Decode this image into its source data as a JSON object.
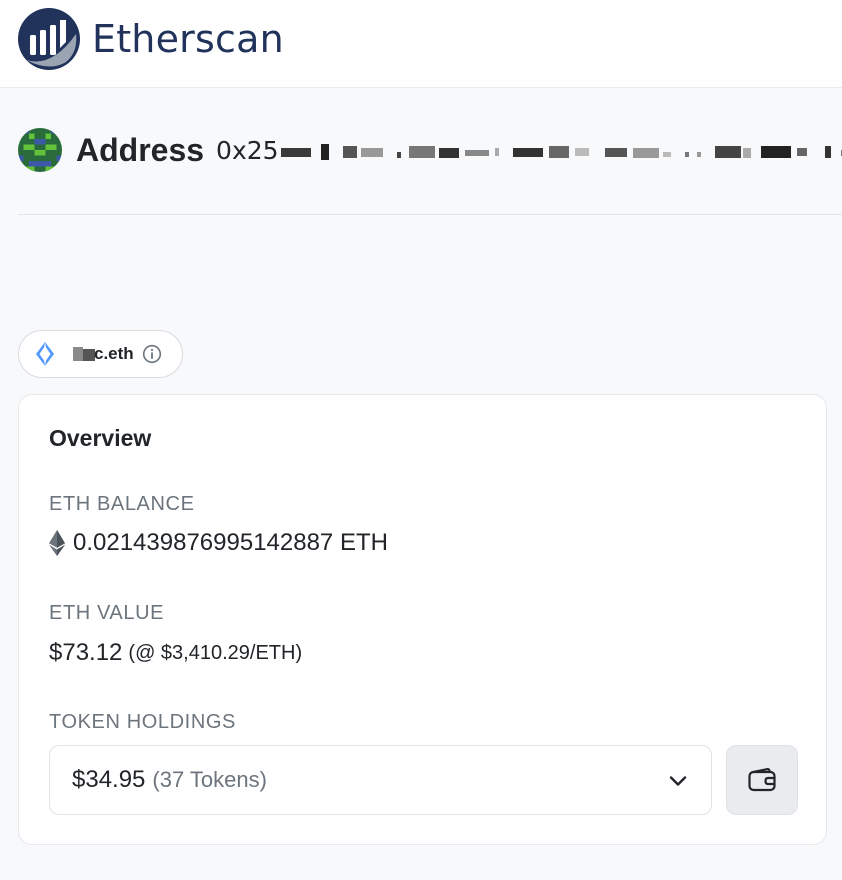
{
  "brand": {
    "name": "Etherscan",
    "primary_color": "#21325b",
    "icon": "etherscan-logo"
  },
  "address": {
    "title": "Address",
    "prefix": "0x25",
    "redacted": true,
    "avatar_icon": "pixel-identicon"
  },
  "ens": {
    "name_suffix": "c.eth",
    "redacted_prefix": true,
    "icon": "ens-icon",
    "info_icon": "info-icon"
  },
  "overview": {
    "title": "Overview",
    "eth_balance_label": "ETH BALANCE",
    "eth_balance_value": "0.021439876995142887 ETH",
    "eth_icon": "ethereum-icon",
    "eth_value_label": "ETH VALUE",
    "eth_value_main": "$73.12",
    "eth_value_rate": "(@ $3,410.29/ETH)",
    "token_holdings_label": "TOKEN HOLDINGS",
    "token_value": "$34.95",
    "token_count": "(37 Tokens)",
    "dropdown_icon": "chevron-down-icon",
    "wallet_icon": "wallet-icon"
  },
  "colors": {
    "page_bg": "#f8f9fb",
    "muted_text": "#6c757d",
    "ens_blue": "#5298ff"
  }
}
